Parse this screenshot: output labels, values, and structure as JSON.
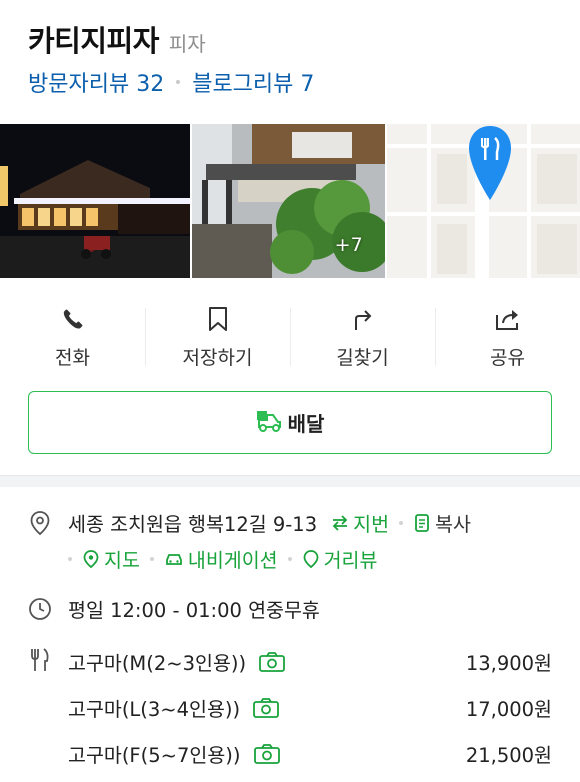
{
  "header": {
    "store_name": "카티지피자",
    "category": "피자"
  },
  "reviews": {
    "visitor": "방문자리뷰 32",
    "blog": "블로그리뷰 7"
  },
  "photos": {
    "more_count": "+7"
  },
  "actions": [
    {
      "label": "전화",
      "icon": "phone-icon"
    },
    {
      "label": "저장하기",
      "icon": "bookmark-icon"
    },
    {
      "label": "길찾기",
      "icon": "directions-icon"
    },
    {
      "label": "공유",
      "icon": "share-icon"
    }
  ],
  "delivery": {
    "label": "배달",
    "icon": "delivery-scooter-icon"
  },
  "address": {
    "text": "세종 조치원읍 행복12길 9-13",
    "jibun_label": "지번",
    "copy_label": "복사",
    "map_label": "지도",
    "navigation_label": "내비게이션",
    "street_view_label": "거리뷰"
  },
  "hours": {
    "text": "평일 12:00 - 01:00 연중무휴"
  },
  "menu": [
    {
      "name": "고구마(M(2~3인용))",
      "price": "13,900원"
    },
    {
      "name": "고구마(L(3~4인용))",
      "price": "17,000원"
    },
    {
      "name": "고구마(F(5~7인용))",
      "price": "21,500원"
    }
  ],
  "colors": {
    "link_blue": "#0b5fad",
    "accent_green": "#18a33b",
    "map_pin_blue": "#1f8cf0"
  }
}
